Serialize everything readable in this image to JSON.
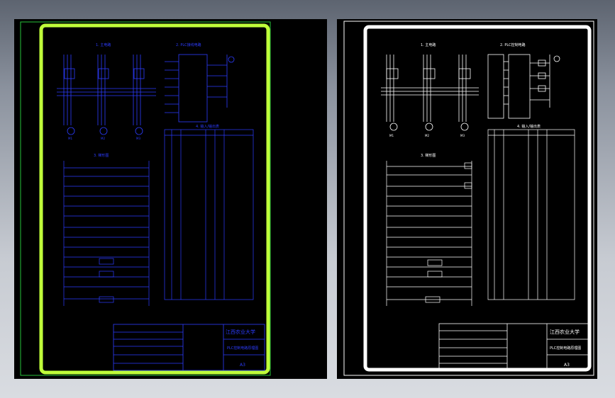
{
  "left_sheet": {
    "section_main_circuit": "1. 主电路",
    "section_plc_io": "2. PLC接线电路",
    "section_control": "3. 梯形图",
    "section_io_table": "4. 输入/输出表",
    "title_block_school": "江西农业大学",
    "title_block_drawing": "PLC控制电路原理图",
    "sheet_number": "A3",
    "motor_labels": [
      "M1",
      "M2",
      "M3"
    ]
  },
  "right_sheet": {
    "section_main_circuit": "1. 主电路",
    "section_plc_io": "2. PLC控制电路",
    "section_control": "3. 梯形图",
    "section_io_table": "4. 输入/输出表",
    "title_block_school": "江西农业大学",
    "title_block_drawing": "PLC控制电路原理图",
    "sheet_number": "A3",
    "motor_labels": [
      "M1",
      "M2",
      "M3"
    ]
  },
  "colors": {
    "background": "#000000",
    "left_frame": "#bfff3a",
    "left_outer_frame": "#27c23a",
    "left_lines": "#2c3cff",
    "right_lines": "#ffffff",
    "workspace": "#d4d7dd"
  }
}
